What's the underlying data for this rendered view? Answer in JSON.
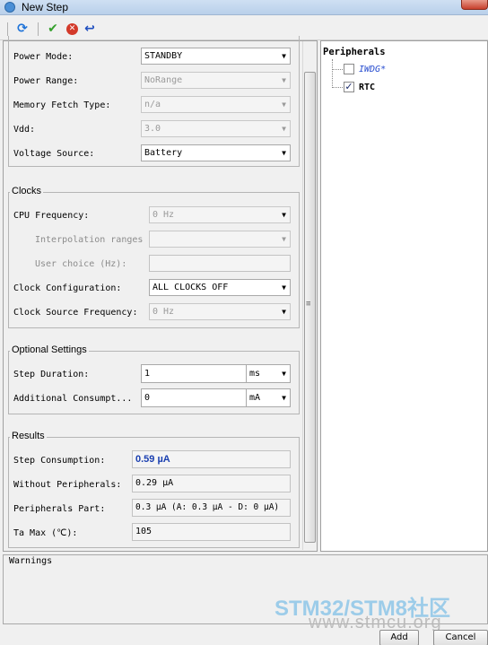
{
  "window": {
    "title": "New Step"
  },
  "toolbar": {
    "icons": [
      "refresh-icon",
      "checkmark-icon",
      "cancel-icon",
      "undo-icon"
    ]
  },
  "power": {
    "power_mode": {
      "label": "Power Mode:",
      "value": "STANDBY"
    },
    "power_range": {
      "label": "Power Range:",
      "value": "NoRange"
    },
    "memory_fetch": {
      "label": "Memory Fetch Type:",
      "value": "n/a"
    },
    "vdd": {
      "label": "Vdd:",
      "value": "3.0"
    },
    "voltage_source": {
      "label": "Voltage Source:",
      "value": "Battery"
    }
  },
  "clocks": {
    "title": "Clocks",
    "cpu_freq": {
      "label": "CPU Frequency:",
      "value": "0 Hz"
    },
    "interp": {
      "label": "Interpolation ranges",
      "value": ""
    },
    "user_choice": {
      "label": "User choice (Hz):",
      "value": ""
    },
    "clock_config": {
      "label": "Clock Configuration:",
      "value": "ALL CLOCKS OFF"
    },
    "clock_source": {
      "label": "Clock Source Frequency:",
      "value": "0 Hz"
    }
  },
  "optional": {
    "title": "Optional Settings",
    "step_duration": {
      "label": "Step Duration:",
      "value": "1",
      "unit": "ms"
    },
    "additional": {
      "label": "Additional Consumpt...",
      "value": "0",
      "unit": "mA"
    }
  },
  "results": {
    "title": "Results",
    "step_consumption": {
      "label": "Step Consumption:",
      "value": "0.59 µA"
    },
    "without_periph": {
      "label": "Without Peripherals:",
      "value": "0.29 µA"
    },
    "periph_part": {
      "label": "Peripherals Part:",
      "value": "0.3 µA  (A: 0.3 µA - D: 0 µA)"
    },
    "ta_max": {
      "label": "Ta Max (℃):",
      "value": "105"
    }
  },
  "peripherals": {
    "title": "Peripherals",
    "items": [
      {
        "label": "IWDG*",
        "checked": false
      },
      {
        "label": "RTC",
        "checked": true
      }
    ]
  },
  "warnings": {
    "title": "Warnings"
  },
  "buttons": {
    "add": "Add",
    "cancel": "Cancel"
  },
  "watermark": {
    "line1": "STM32/STM8社区",
    "line2": "www.stmcu.org"
  }
}
